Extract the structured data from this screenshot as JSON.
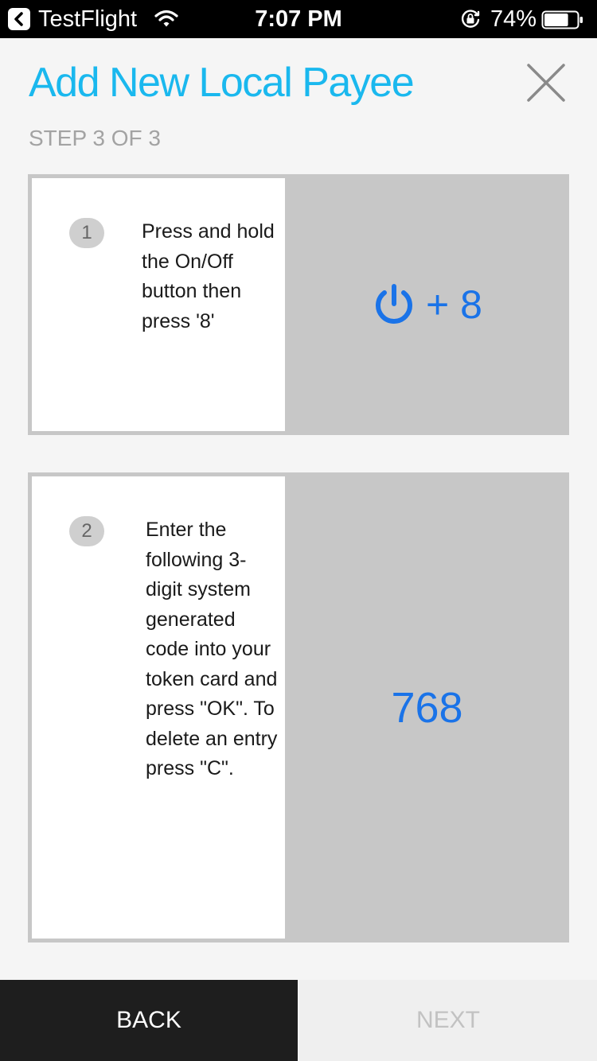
{
  "status_bar": {
    "app_name": "TestFlight",
    "time": "7:07 PM",
    "battery_percent": "74%",
    "battery_level": 0.74
  },
  "header": {
    "title": "Add New Local Payee",
    "step": "STEP 3 OF 3"
  },
  "steps": [
    {
      "number": "1",
      "instruction": "Press and hold the On/Off button then press '8'",
      "key_combo": "+ 8"
    },
    {
      "number": "2",
      "instruction": "Enter the following 3-digit system generated code into your token card and press \"OK\". To delete an entry press \"C\".",
      "code": "768"
    }
  ],
  "footer": {
    "back_label": "BACK",
    "next_label": "NEXT"
  },
  "colors": {
    "title": "#1ab8ee",
    "accent": "#1a73e8"
  }
}
